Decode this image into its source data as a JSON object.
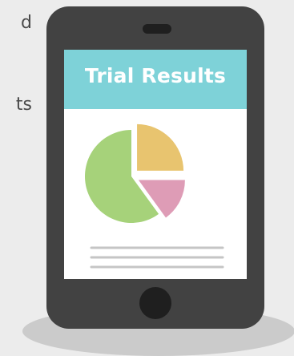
{
  "side_text": {
    "line1": "d",
    "line2": "ts"
  },
  "screen": {
    "title": "Trial Results"
  },
  "colors": {
    "phone_body": "#424242",
    "screen_header": "#7ed2d8",
    "pie_yellow": "#e8c46f",
    "pie_pink": "#de9cb6",
    "pie_green": "#a6d27a",
    "text_lines": "#c5c5c5"
  },
  "chart_data": {
    "type": "pie",
    "slices": [
      {
        "value": 25,
        "color": "#e8c46f",
        "exploded": true
      },
      {
        "value": 15,
        "color": "#de9cb6",
        "exploded": true
      },
      {
        "value": 60,
        "color": "#a6d27a",
        "exploded": false
      }
    ]
  }
}
